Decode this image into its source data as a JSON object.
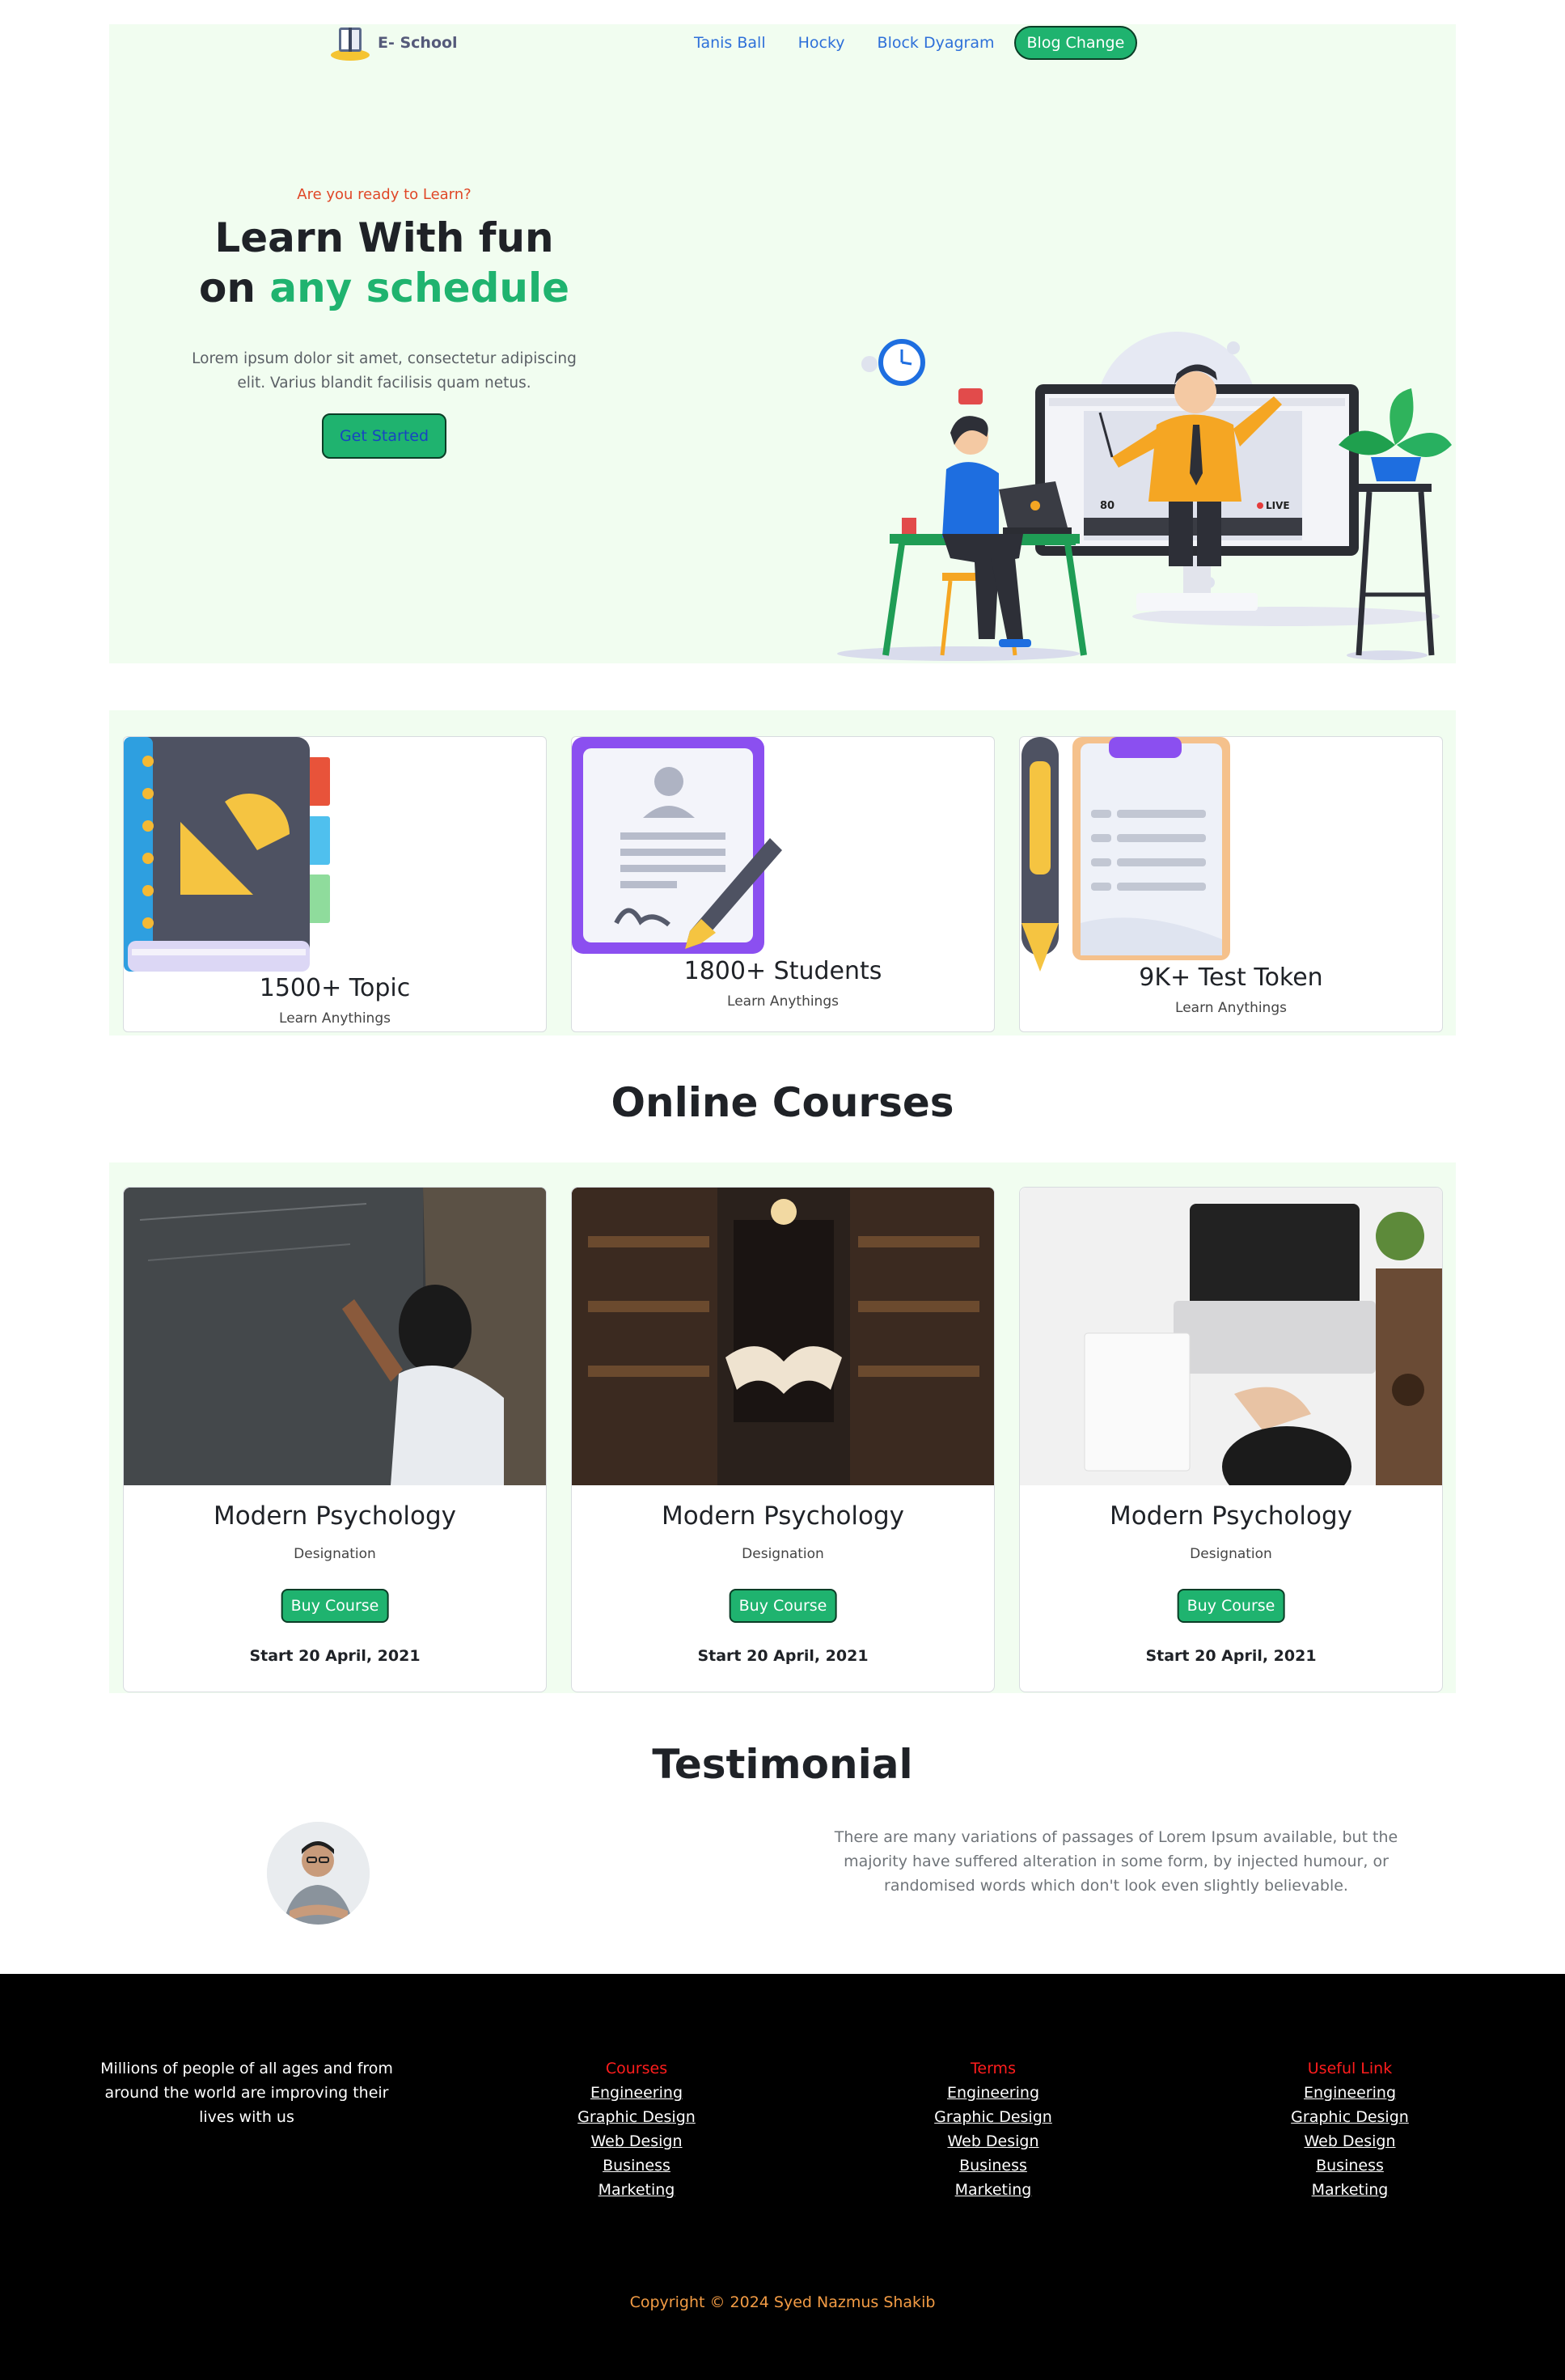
{
  "header": {
    "logo_text": "E- School",
    "nav": [
      {
        "label": "Tanis Ball"
      },
      {
        "label": "Hocky"
      },
      {
        "label": "Block Dyagram"
      }
    ],
    "cta_label": "Blog Change"
  },
  "hero": {
    "eyebrow": "Are you ready to Learn?",
    "headline_line1": "Learn With fun",
    "headline_on": "on ",
    "headline_accent": "any schedule",
    "lead": "Lorem ipsum dolor sit amet, consectetur adipiscing elit. Varius blandit facilisis quam netus.",
    "button_label": "Get Started",
    "illustration_icon": "online-teaching-illustration"
  },
  "stats": [
    {
      "title": "1500+ Topic",
      "sub": "Learn Anythings",
      "icon": "notebook-ruler-icon"
    },
    {
      "title": "1800+ Students",
      "sub": "Learn Anythings",
      "icon": "profile-document-pen-icon"
    },
    {
      "title": "9K+ Test Token",
      "sub": "Learn Anythings",
      "icon": "clipboard-pen-icon"
    }
  ],
  "courses_section": {
    "title": "Online Courses",
    "items": [
      {
        "name": "Modern Psychology",
        "sub": "Designation",
        "button": "Buy Course",
        "date": "Start 20 April, 2021",
        "image": "girl-writing-on-chalkboard-photo"
      },
      {
        "name": "Modern Psychology",
        "sub": "Designation",
        "button": "Buy Course",
        "date": "Start 20 April, 2021",
        "image": "library-floating-book-photo"
      },
      {
        "name": "Modern Psychology",
        "sub": "Designation",
        "button": "Buy Course",
        "date": "Start 20 April, 2021",
        "image": "person-at-laptop-desk-photo"
      }
    ]
  },
  "testimonial": {
    "title": "Testimonial",
    "quote": "There are many variations of passages of Lorem Ipsum available, but the majority have suffered alteration in some form, by injected humour, or randomised words which don't look even slightly believable.",
    "avatar": "man-crossed-arms-avatar"
  },
  "footer": {
    "about": "Millions of people of all ages and from around the world are improving their lives with us",
    "columns": [
      {
        "heading": "Courses",
        "links": [
          "Engineering",
          "Graphic Design",
          "Web Design",
          "Business",
          "Marketing"
        ]
      },
      {
        "heading": "Terms",
        "links": [
          "Engineering",
          "Graphic Design",
          "Web Design",
          "Business",
          "Marketing"
        ]
      },
      {
        "heading": "Useful Link",
        "links": [
          "Engineering",
          "Graphic Design",
          "Web Design",
          "Business",
          "Marketing"
        ]
      }
    ],
    "copyright": "Copyright © 2024 Syed Nazmus Shakib"
  },
  "colors": {
    "brand_green": "#1fb36f",
    "hero_bg": "#f1fdf0",
    "eyebrow_red": "#e04727",
    "link_blue": "#2e70d9",
    "footer_heading_red": "#ff1d1d",
    "copyright_orange": "#f29b44"
  }
}
